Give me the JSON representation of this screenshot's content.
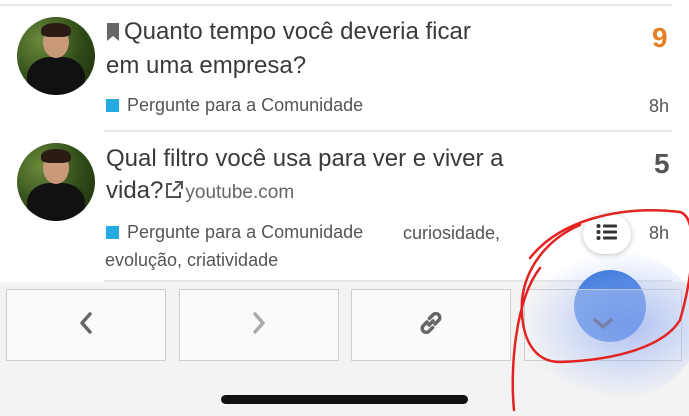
{
  "topics": [
    {
      "title_line1": "Quanto tempo você deveria ficar",
      "title_line2": "em uma empresa?",
      "category": "Pergunte para a Comunidade",
      "replies": "9",
      "replies_color": "#e67e22",
      "age": "8h",
      "bookmarked": true
    },
    {
      "title_line1": "Qual filtro você usa para ver e viver a",
      "title_line2": "vida?",
      "domain": "youtube.com",
      "category": "Pergunte para a Comunidade",
      "tags_line1": "curiosidade,",
      "tags_line2": "evolução, criatividade",
      "replies": "5",
      "replies_color": "#555555",
      "age": "8h"
    }
  ],
  "colors": {
    "category": "#25aae1",
    "annotation": "#e32222"
  },
  "icons": {
    "bookmark": "bookmark-icon",
    "external_link": "external-link-icon",
    "list": "list-icon",
    "prev": "chevron-left-icon",
    "next": "chevron-right-icon",
    "link": "link-icon",
    "down": "chevron-down-icon"
  }
}
